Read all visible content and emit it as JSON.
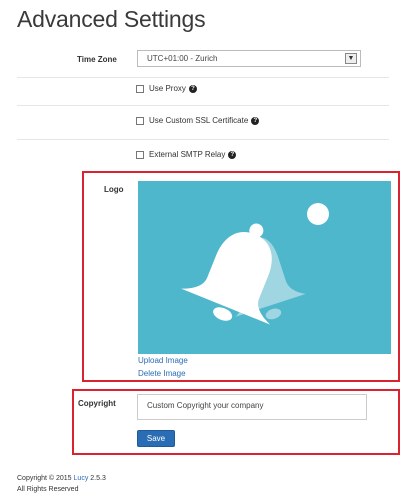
{
  "page": {
    "title": "Advanced Settings"
  },
  "timezone": {
    "label": "Time Zone",
    "value": "UTC+01:00 - Zurich"
  },
  "options": {
    "use_proxy": {
      "label": "Use Proxy",
      "checked": false
    },
    "use_ssl": {
      "label": "Use Custom SSL Certificate",
      "checked": false
    },
    "smtp_relay": {
      "label": "External SMTP Relay",
      "checked": false
    }
  },
  "logo": {
    "label": "Logo",
    "upload_link": "Upload Image",
    "delete_link": "Delete Image"
  },
  "copyright": {
    "label": "Copyright",
    "value": "Custom Copyright your company"
  },
  "actions": {
    "save_label": "Save"
  },
  "footer": {
    "prefix": "Copyright © 2015",
    "brand": "Lucy",
    "version": "2.5.3",
    "rights": "All Rights Reserved"
  },
  "colors": {
    "highlight": "#d9232e",
    "logo_background": "#4eb7cc",
    "button": "#2a6db5",
    "link": "#2a6db5"
  }
}
